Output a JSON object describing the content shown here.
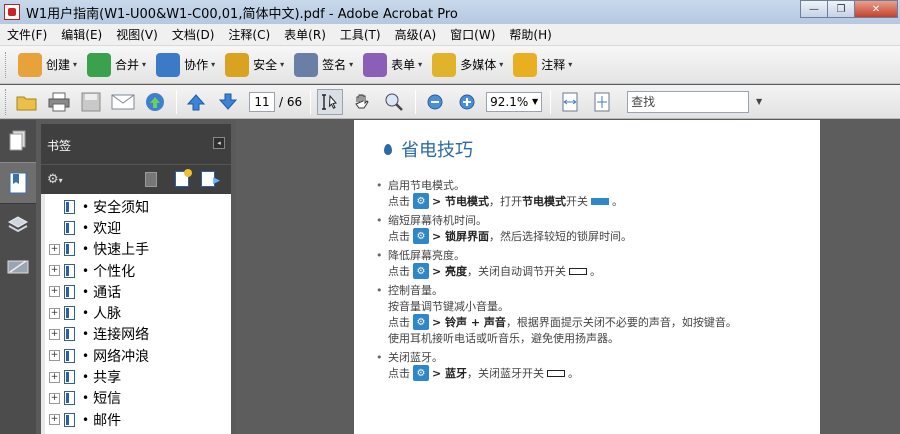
{
  "window": {
    "title": "W1用户指南(W1-U00&W1-C00,01,简体中文).pdf - Adobe Acrobat Pro",
    "minimize": "—",
    "restore": "❐",
    "close": "✕"
  },
  "menu": [
    "文件(F)",
    "编辑(E)",
    "视图(V)",
    "文档(D)",
    "注释(C)",
    "表单(R)",
    "工具(T)",
    "高级(A)",
    "窗口(W)",
    "帮助(H)"
  ],
  "tasks": [
    {
      "label": "创建",
      "icon": "create-icon",
      "color": "#e8a23a"
    },
    {
      "label": "合并",
      "icon": "combine-icon",
      "color": "#3aa24c"
    },
    {
      "label": "协作",
      "icon": "collaborate-icon",
      "color": "#3c7ac8"
    },
    {
      "label": "安全",
      "icon": "lock-icon",
      "color": "#d9a321"
    },
    {
      "label": "签名",
      "icon": "pen-icon",
      "color": "#6b7fa6"
    },
    {
      "label": "表单",
      "icon": "form-icon",
      "color": "#8b5fb5"
    },
    {
      "label": "多媒体",
      "icon": "multimedia-icon",
      "color": "#e0b42a"
    },
    {
      "label": "注释",
      "icon": "comment-icon",
      "color": "#e8b020"
    }
  ],
  "toolbar": {
    "page_current": "11",
    "page_total": "/ 66",
    "zoom": "92.1%",
    "search_placeholder": "查找"
  },
  "bookmarks_panel": {
    "title": "书签",
    "collapse": "◂",
    "items": [
      {
        "label": "安全须知",
        "expandable": false
      },
      {
        "label": "欢迎",
        "expandable": false
      },
      {
        "label": "快速上手",
        "expandable": true
      },
      {
        "label": "个性化",
        "expandable": true
      },
      {
        "label": "通话",
        "expandable": true
      },
      {
        "label": "人脉",
        "expandable": true
      },
      {
        "label": "连接网络",
        "expandable": true
      },
      {
        "label": "网络冲浪",
        "expandable": true
      },
      {
        "label": "共享",
        "expandable": true
      },
      {
        "label": "短信",
        "expandable": true
      },
      {
        "label": "邮件",
        "expandable": true
      }
    ]
  },
  "document": {
    "heading": "省电技巧",
    "settings_glyph": "⚙",
    "tips": [
      {
        "title": "启用节电模式。",
        "pre": "点击",
        "path": "> 节电模式",
        "after": "，打开",
        "bold2": "节电模式",
        "tail": "开关",
        "toggle": "on",
        "end": "。"
      },
      {
        "title": "缩短屏幕待机时间。",
        "pre": "点击",
        "path": "> 锁屏界面",
        "after": "，然后选择较短的锁屏时间。"
      },
      {
        "title": "降低屏幕亮度。",
        "pre": "点击",
        "path": "> 亮度",
        "after": "，关闭自动调节开关",
        "toggle": "off",
        "end": "。"
      },
      {
        "title": "控制音量。",
        "line2": "按音量调节键减小音量。",
        "pre": "点击",
        "path": "> 铃声 + 声音",
        "after": "，根据界面提示关闭不必要的声音，如按键音。",
        "line4": "使用耳机接听电话或听音乐，避免使用扬声器。"
      },
      {
        "title": "关闭蓝牙。",
        "pre": "点击",
        "path": "> 蓝牙",
        "after": "，关闭蓝牙开关",
        "toggle": "off",
        "end": "。"
      }
    ]
  }
}
